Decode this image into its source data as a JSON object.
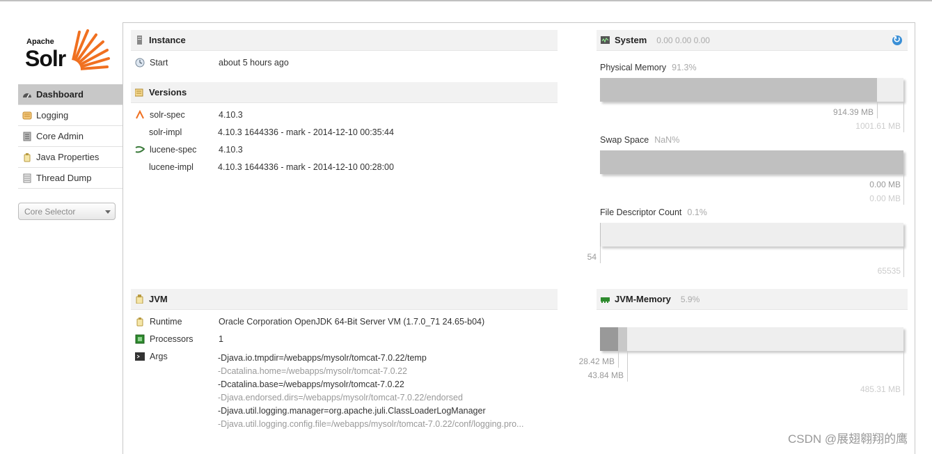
{
  "logo": {
    "apache": "Apache",
    "solr": "Solr"
  },
  "nav": {
    "items": [
      {
        "label": "Dashboard",
        "icon": "dashboard-icon",
        "active": true
      },
      {
        "label": "Logging",
        "icon": "logging-icon"
      },
      {
        "label": "Core Admin",
        "icon": "core-admin-icon"
      },
      {
        "label": "Java Properties",
        "icon": "java-properties-icon"
      },
      {
        "label": "Thread Dump",
        "icon": "thread-dump-icon"
      }
    ],
    "core_selector": "Core Selector"
  },
  "instance": {
    "title": "Instance",
    "start_label": "Start",
    "start_value": "about 5 hours ago"
  },
  "versions": {
    "title": "Versions",
    "rows": [
      {
        "label": "solr-spec",
        "value": "4.10.3"
      },
      {
        "label": "solr-impl",
        "value": "4.10.3 1644336 - mark - 2014-12-10 00:35:44"
      },
      {
        "label": "lucene-spec",
        "value": "4.10.3"
      },
      {
        "label": "lucene-impl",
        "value": "4.10.3 1644336 - mark - 2014-12-10 00:28:00"
      }
    ]
  },
  "jvm": {
    "title": "JVM",
    "runtime_label": "Runtime",
    "runtime_value": "Oracle Corporation OpenJDK 64-Bit Server VM (1.7.0_71 24.65-b04)",
    "processors_label": "Processors",
    "processors_value": "1",
    "args_label": "Args",
    "args": [
      "-Djava.io.tmpdir=/webapps/mysolr/tomcat-7.0.22/temp",
      "-Dcatalina.home=/webapps/mysolr/tomcat-7.0.22",
      "-Dcatalina.base=/webapps/mysolr/tomcat-7.0.22",
      "-Djava.endorsed.dirs=/webapps/mysolr/tomcat-7.0.22/endorsed",
      "-Djava.util.logging.manager=org.apache.juli.ClassLoaderLogManager",
      "-Djava.util.logging.config.file=/webapps/mysolr/tomcat-7.0.22/conf/logging.pro..."
    ]
  },
  "system": {
    "title": "System",
    "load": "0.00  0.00  0.00",
    "physical_memory": {
      "label": "Physical Memory",
      "pct": "91.3%",
      "fraction": 0.913,
      "used": "914.39 MB",
      "total": "1001.61 MB"
    },
    "swap_space": {
      "label": "Swap Space",
      "pct": "NaN%",
      "fraction": 1.0,
      "used": "0.00 MB",
      "total": "0.00 MB"
    },
    "file_descriptor": {
      "label": "File Descriptor Count",
      "pct": "0.1%",
      "fraction": 0.001,
      "used": "54",
      "total": "65535"
    }
  },
  "jvm_memory": {
    "title": "JVM-Memory",
    "pct": "5.9%",
    "used_fraction": 0.059,
    "committed_fraction": 0.09,
    "used": "28.42 MB",
    "committed": "43.84 MB",
    "max": "485.31 MB"
  },
  "watermark": "CSDN @展翅翱翔的鹰",
  "colors": {
    "bar_fill": "#c0c0c0",
    "bar_bg": "#eeeeee",
    "jvm_used": "#999999",
    "jvm_committed": "#c8c8c8",
    "refresh": "#3a8fd6"
  }
}
